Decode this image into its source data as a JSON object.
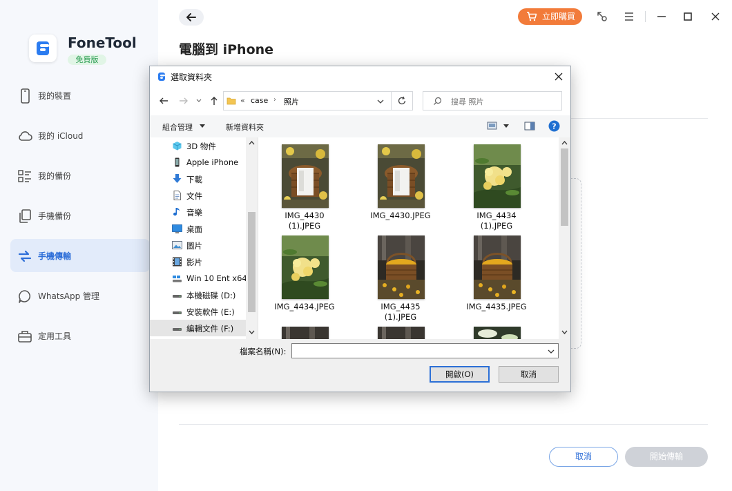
{
  "app": {
    "name": "FoneTool",
    "edition": "免費版",
    "buy_label": "立即購買",
    "page_title": "電腦到 iPhone",
    "cancel_label": "取消",
    "start_label": "開始傳輸",
    "accent_color": "#2d6ed8",
    "buy_color": "#f27b3a"
  },
  "sidebar": {
    "items": [
      {
        "label": "我的裝置",
        "icon": "phone-icon"
      },
      {
        "label": "我的 iCloud",
        "icon": "cloud-icon"
      },
      {
        "label": "我的備份",
        "icon": "backup-list-icon"
      },
      {
        "label": "手機備份",
        "icon": "copy-icon"
      },
      {
        "label": "手機傳輸",
        "icon": "transfer-icon",
        "active": true
      },
      {
        "label": "WhatsApp 管理",
        "icon": "chat-bubble-icon"
      },
      {
        "label": "定用工具",
        "icon": "toolbox-icon"
      }
    ]
  },
  "dialog": {
    "title": "選取資料夾",
    "breadcrumb": {
      "prefix": "«",
      "parts": [
        "case",
        "照片"
      ]
    },
    "search_placeholder": "搜尋 照片",
    "organize_label": "組合管理",
    "new_folder_label": "新增資料夾",
    "tree": [
      {
        "label": "3D 物件",
        "icon": "3d-objects-icon"
      },
      {
        "label": "Apple iPhone",
        "icon": "iphone-device-icon"
      },
      {
        "label": "下載",
        "icon": "download-icon"
      },
      {
        "label": "文件",
        "icon": "document-icon"
      },
      {
        "label": "音樂",
        "icon": "music-note-icon"
      },
      {
        "label": "桌面",
        "icon": "desktop-icon"
      },
      {
        "label": "圖片",
        "icon": "pictures-icon"
      },
      {
        "label": "影片",
        "icon": "video-icon"
      },
      {
        "label": "Win 10 Ent x64",
        "icon": "system-drive-icon"
      },
      {
        "label": "本機磁碟 (D:)",
        "icon": "drive-icon"
      },
      {
        "label": "安裝軟件 (E:)",
        "icon": "drive-icon"
      },
      {
        "label": "編輯文件 (F:)",
        "icon": "drive-icon",
        "selected": true
      }
    ],
    "files": [
      {
        "name": "IMG_4430\n(1).JPEG",
        "kind": "basket-white"
      },
      {
        "name": "IMG_4430.JPEG",
        "kind": "basket-white"
      },
      {
        "name": "IMG_4434\n(1).JPEG",
        "kind": "flowers"
      },
      {
        "name": "IMG_4434.JPEG",
        "kind": "flowers"
      },
      {
        "name": "IMG_4435\n(1).JPEG",
        "kind": "basket-yellow"
      },
      {
        "name": "IMG_4435.JPEG",
        "kind": "basket-yellow"
      },
      {
        "name": "",
        "kind": "partial-dark"
      },
      {
        "name": "",
        "kind": "partial-dark"
      },
      {
        "name": "",
        "kind": "partial-leaves"
      }
    ],
    "filename_label": "檔案名稱(N):",
    "filename_value": "",
    "open_label": "開啟(O)",
    "cancel_label": "取消"
  }
}
